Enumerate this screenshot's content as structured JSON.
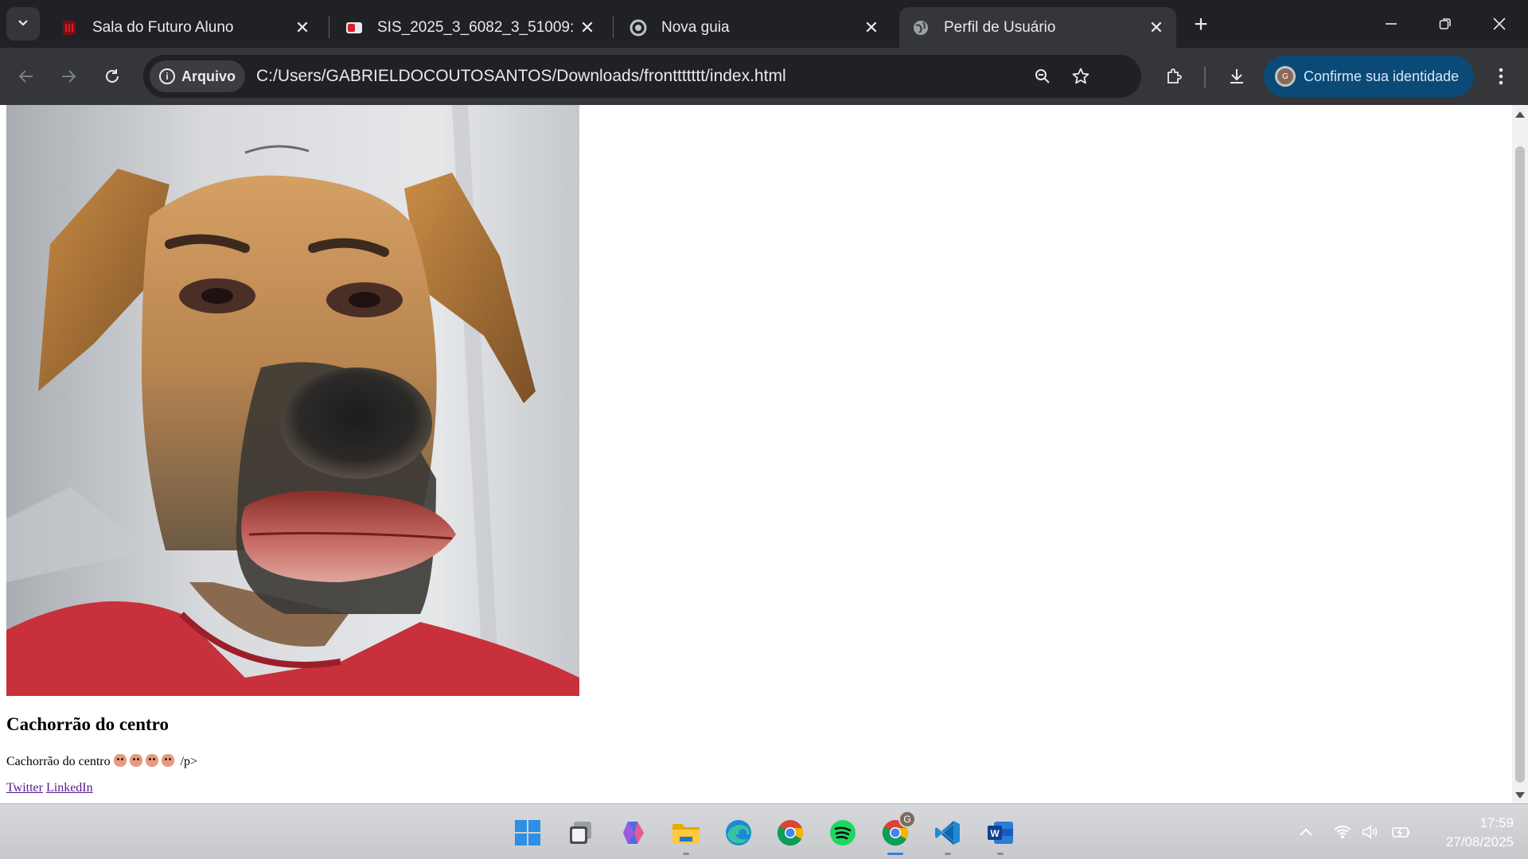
{
  "browser": {
    "tabs": [
      {
        "title": "Sala do Futuro Aluno",
        "favicon": "sala-do-futuro-icon",
        "active": false
      },
      {
        "title": "SIS_2025_3_6082_3_51009: S19",
        "favicon": "sis-icon",
        "active": false
      },
      {
        "title": "Nova guia",
        "favicon": "chrome-icon",
        "active": false
      },
      {
        "title": "Perfil de Usuário",
        "favicon": "globe-icon",
        "active": true
      }
    ],
    "omnibox": {
      "chip_label": "Arquivo",
      "url": "C:/Users/GABRIELDOCOUTOSANTOS/Downloads/fronttttttt/index.html"
    },
    "identity_button": "Confirme sua identidade",
    "identity_avatar_letter": "G"
  },
  "page": {
    "heading": "Cachorrão do centro",
    "paragraph_text": "Cachorrão do centro",
    "paragraph_trailing": "/p>",
    "emoji_count": 4,
    "links": {
      "twitter": "Twitter",
      "linkedin": "LinkedIn"
    }
  },
  "taskbar": {
    "apps": [
      "windows-start-icon",
      "task-view-icon",
      "copilot-icon",
      "file-explorer-icon",
      "edge-icon",
      "chrome-icon",
      "spotify-icon",
      "chrome-profile-icon",
      "vscode-icon",
      "word-icon"
    ],
    "chrome_profile_badge": "G",
    "time": "17:59",
    "date": "27/08/2025"
  },
  "colors": {
    "tabstrip_bg": "#202124",
    "toolbar_bg": "#35363a",
    "identity_bg": "#0b4a77",
    "visited_link": "#551a8b"
  }
}
